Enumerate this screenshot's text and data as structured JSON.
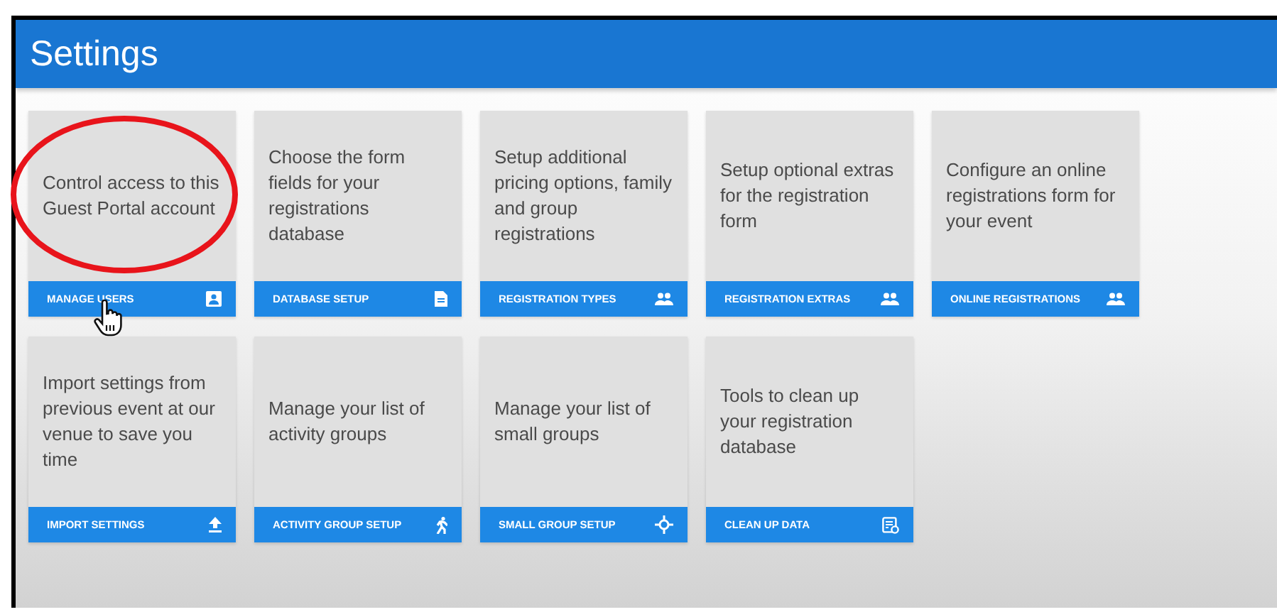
{
  "header": {
    "title": "Settings"
  },
  "cards": [
    {
      "description": "Control access to this Guest Portal account",
      "button": "MANAGE USERS"
    },
    {
      "description": "Choose the form fields for your registrations database",
      "button": "DATABASE SETUP"
    },
    {
      "description": "Setup additional pricing options, family and group registrations",
      "button": "REGISTRATION TYPES"
    },
    {
      "description": "Setup optional extras for the registration form",
      "button": "REGISTRATION EXTRAS"
    },
    {
      "description": "Configure an online registrations form for your event",
      "button": "ONLINE REGISTRATIONS"
    },
    {
      "description": "Import settings from previous event at our venue to save you time",
      "button": "IMPORT SETTINGS"
    },
    {
      "description": "Manage your list of activity groups",
      "button": "ACTIVITY GROUP SETUP"
    },
    {
      "description": "Manage your list of small groups",
      "button": "SMALL GROUP SETUP"
    },
    {
      "description": "Tools to clean up your registration database",
      "button": "CLEAN UP DATA"
    }
  ]
}
